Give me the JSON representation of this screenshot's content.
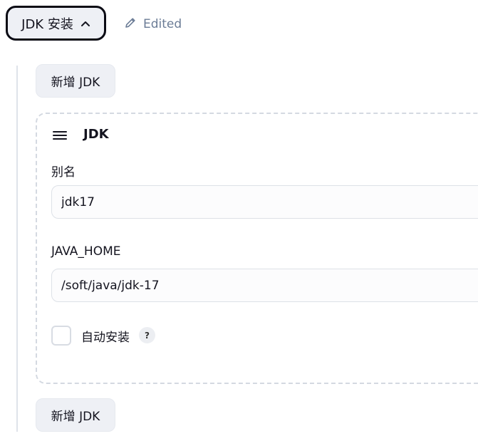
{
  "section": {
    "toggle_label": "JDK 安装",
    "edited_label": "Edited"
  },
  "add_button_label": "新增 JDK",
  "jdk_card": {
    "title": "JDK",
    "alias_label": "别名",
    "alias_value": "jdk17",
    "java_home_label": "JAVA_HOME",
    "java_home_value": "/soft/java/jdk-17",
    "auto_install_label": "自动安装",
    "auto_install_checked": false,
    "help_label": "?"
  },
  "icons": {
    "toggle": "chevron-up-icon",
    "edited": "pencil-icon",
    "drag": "drag-handle-icon"
  },
  "colors": {
    "button_bg": "#eef0f5",
    "edited_text": "#6b7c96",
    "border": "#dde1e7"
  }
}
